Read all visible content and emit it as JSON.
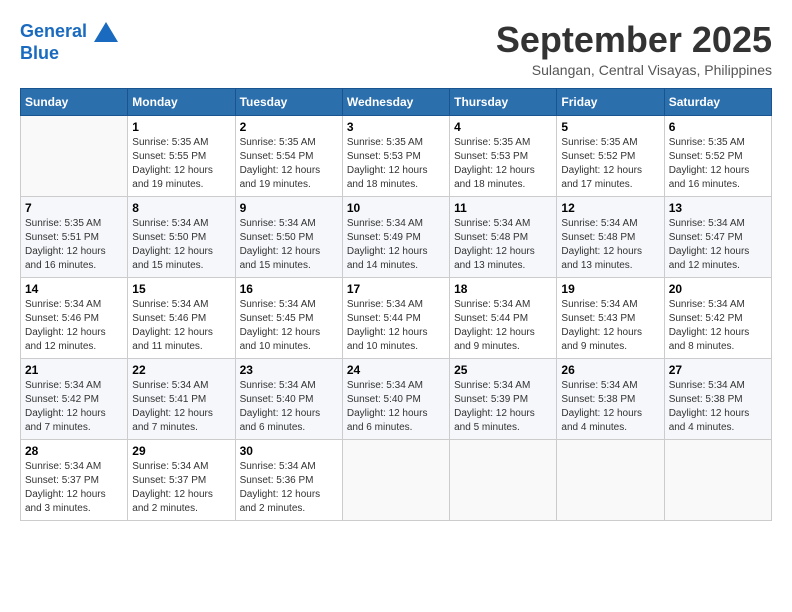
{
  "header": {
    "logo_line1": "General",
    "logo_line2": "Blue",
    "month": "September 2025",
    "location": "Sulangan, Central Visayas, Philippines"
  },
  "weekdays": [
    "Sunday",
    "Monday",
    "Tuesday",
    "Wednesday",
    "Thursday",
    "Friday",
    "Saturday"
  ],
  "weeks": [
    [
      {
        "day": "",
        "info": ""
      },
      {
        "day": "1",
        "info": "Sunrise: 5:35 AM\nSunset: 5:55 PM\nDaylight: 12 hours\nand 19 minutes."
      },
      {
        "day": "2",
        "info": "Sunrise: 5:35 AM\nSunset: 5:54 PM\nDaylight: 12 hours\nand 19 minutes."
      },
      {
        "day": "3",
        "info": "Sunrise: 5:35 AM\nSunset: 5:53 PM\nDaylight: 12 hours\nand 18 minutes."
      },
      {
        "day": "4",
        "info": "Sunrise: 5:35 AM\nSunset: 5:53 PM\nDaylight: 12 hours\nand 18 minutes."
      },
      {
        "day": "5",
        "info": "Sunrise: 5:35 AM\nSunset: 5:52 PM\nDaylight: 12 hours\nand 17 minutes."
      },
      {
        "day": "6",
        "info": "Sunrise: 5:35 AM\nSunset: 5:52 PM\nDaylight: 12 hours\nand 16 minutes."
      }
    ],
    [
      {
        "day": "7",
        "info": "Sunrise: 5:35 AM\nSunset: 5:51 PM\nDaylight: 12 hours\nand 16 minutes."
      },
      {
        "day": "8",
        "info": "Sunrise: 5:34 AM\nSunset: 5:50 PM\nDaylight: 12 hours\nand 15 minutes."
      },
      {
        "day": "9",
        "info": "Sunrise: 5:34 AM\nSunset: 5:50 PM\nDaylight: 12 hours\nand 15 minutes."
      },
      {
        "day": "10",
        "info": "Sunrise: 5:34 AM\nSunset: 5:49 PM\nDaylight: 12 hours\nand 14 minutes."
      },
      {
        "day": "11",
        "info": "Sunrise: 5:34 AM\nSunset: 5:48 PM\nDaylight: 12 hours\nand 13 minutes."
      },
      {
        "day": "12",
        "info": "Sunrise: 5:34 AM\nSunset: 5:48 PM\nDaylight: 12 hours\nand 13 minutes."
      },
      {
        "day": "13",
        "info": "Sunrise: 5:34 AM\nSunset: 5:47 PM\nDaylight: 12 hours\nand 12 minutes."
      }
    ],
    [
      {
        "day": "14",
        "info": "Sunrise: 5:34 AM\nSunset: 5:46 PM\nDaylight: 12 hours\nand 12 minutes."
      },
      {
        "day": "15",
        "info": "Sunrise: 5:34 AM\nSunset: 5:46 PM\nDaylight: 12 hours\nand 11 minutes."
      },
      {
        "day": "16",
        "info": "Sunrise: 5:34 AM\nSunset: 5:45 PM\nDaylight: 12 hours\nand 10 minutes."
      },
      {
        "day": "17",
        "info": "Sunrise: 5:34 AM\nSunset: 5:44 PM\nDaylight: 12 hours\nand 10 minutes."
      },
      {
        "day": "18",
        "info": "Sunrise: 5:34 AM\nSunset: 5:44 PM\nDaylight: 12 hours\nand 9 minutes."
      },
      {
        "day": "19",
        "info": "Sunrise: 5:34 AM\nSunset: 5:43 PM\nDaylight: 12 hours\nand 9 minutes."
      },
      {
        "day": "20",
        "info": "Sunrise: 5:34 AM\nSunset: 5:42 PM\nDaylight: 12 hours\nand 8 minutes."
      }
    ],
    [
      {
        "day": "21",
        "info": "Sunrise: 5:34 AM\nSunset: 5:42 PM\nDaylight: 12 hours\nand 7 minutes."
      },
      {
        "day": "22",
        "info": "Sunrise: 5:34 AM\nSunset: 5:41 PM\nDaylight: 12 hours\nand 7 minutes."
      },
      {
        "day": "23",
        "info": "Sunrise: 5:34 AM\nSunset: 5:40 PM\nDaylight: 12 hours\nand 6 minutes."
      },
      {
        "day": "24",
        "info": "Sunrise: 5:34 AM\nSunset: 5:40 PM\nDaylight: 12 hours\nand 6 minutes."
      },
      {
        "day": "25",
        "info": "Sunrise: 5:34 AM\nSunset: 5:39 PM\nDaylight: 12 hours\nand 5 minutes."
      },
      {
        "day": "26",
        "info": "Sunrise: 5:34 AM\nSunset: 5:38 PM\nDaylight: 12 hours\nand 4 minutes."
      },
      {
        "day": "27",
        "info": "Sunrise: 5:34 AM\nSunset: 5:38 PM\nDaylight: 12 hours\nand 4 minutes."
      }
    ],
    [
      {
        "day": "28",
        "info": "Sunrise: 5:34 AM\nSunset: 5:37 PM\nDaylight: 12 hours\nand 3 minutes."
      },
      {
        "day": "29",
        "info": "Sunrise: 5:34 AM\nSunset: 5:37 PM\nDaylight: 12 hours\nand 2 minutes."
      },
      {
        "day": "30",
        "info": "Sunrise: 5:34 AM\nSunset: 5:36 PM\nDaylight: 12 hours\nand 2 minutes."
      },
      {
        "day": "",
        "info": ""
      },
      {
        "day": "",
        "info": ""
      },
      {
        "day": "",
        "info": ""
      },
      {
        "day": "",
        "info": ""
      }
    ]
  ]
}
